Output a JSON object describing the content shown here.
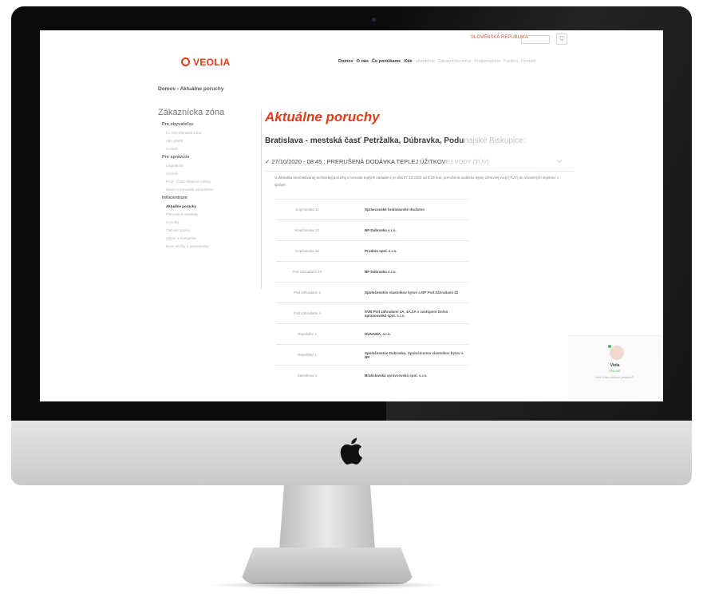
{
  "site": {
    "region_link": "SLOVENSKÁ REPUBLIKA",
    "search_button": "Q",
    "logo_text": "VEOLIA",
    "nav": [
      {
        "label": "Domov",
        "strong": true
      },
      {
        "label": "O nás",
        "strong": true
      },
      {
        "label": "Čo ponúkame",
        "strong": true
      },
      {
        "label": "Kde",
        "strong": true
      },
      {
        "label": "pôsobíme",
        "strong": false
      },
      {
        "label": "Zákaznícka zóna",
        "strong": false
      },
      {
        "label": "Podporujeme",
        "strong": false
      },
      {
        "label": "Kariéra",
        "strong": false
      },
      {
        "label": "Kontakt",
        "strong": false
      }
    ],
    "breadcrumb": "Domov › Aktuálne poruchy"
  },
  "sidebar": {
    "title": "Zákaznícka zóna",
    "groups": [
      {
        "heading": "Pre obyvateľov",
        "items": [
          "Čo řieš klientská zóna",
          "Ako ušetriť",
          "Kontakt"
        ]
      },
      {
        "heading": "Pre správcov",
        "items": [
          "Legislatíva",
          "Vzorník",
          "FAQ - Často kladené otázky",
          "Návrh a prevzatie vodomerov"
        ]
      },
      {
        "heading": "Infocentrum",
        "items": [
          "Aktuálne poruchy",
          "Plánované odstávky",
          "Cenníky",
          "Tlačové správy",
          "Zákon o energetike",
          "Nové služby a pripomienky"
        ]
      }
    ],
    "active_item": "Aktuálne poruchy"
  },
  "main": {
    "title": "Aktuálne poruchy",
    "location_bold": "Bratislava - mestská časť Petržalka, Dúbravka, Podu",
    "location_faded": "najské Biskupice:",
    "incident_bold": "✓ 27/10/2020 - 08:45 : PRERUŠENÁ DODÁVKA TEPLEJ ÚŽITKOV",
    "incident_faded": "EJ VODY (TÚV)",
    "description": "V dôsledku neočakávanej technickej poruchy v rozvode teplých zariadení, je dňa 27.10.2020 od 8:29 hod. prerušená dodávka teplej úžitkovej vody (TÚV) do uvedených objektov v správe:",
    "rows": [
      {
        "address": "Kopčianska 11",
        "dash": "-",
        "manager": "Správcovské bratislavské družstvo"
      },
      {
        "address": "Kopčianska 13",
        "dash": "-",
        "manager": "BP Dúbravka s.r.o."
      },
      {
        "address": "Kopčianska 15",
        "dash": "-",
        "manager": "Prodom spol. s.r.o."
      },
      {
        "address": "Pod záhradami 2A",
        "dash": "-",
        "manager": "BP Dúbravka s.r.o."
      },
      {
        "address": "Pod záhradami 2",
        "dash": "-",
        "manager": "Spoločenstvo vlastníkov bytov a NP Pod Záhradami 42"
      },
      {
        "address": "Pod záhradami 4",
        "dash": "-",
        "manager": "SVB Pod záhradami 4A, 4A,2A v zastúpení Dolná správcovská spol. s.r.o."
      },
      {
        "address": "Republiky 1",
        "dash": "-",
        "manager": "DUNAMA, s.r.o."
      },
      {
        "address": "Republiky 1",
        "dash": "-",
        "manager": "Spoločenstvo Dubravka, Spoločenstvo vlastníkov bytov a NP"
      },
      {
        "address": "Sasinkova 1",
        "dash": "-",
        "manager": "Bratislavská správcovská spol. s.r.o."
      }
    ]
  },
  "chat": {
    "name": "Viola",
    "status": "ONLINE",
    "question": "Ako Vám môžem pomôcť?"
  },
  "colors": {
    "brand": "#e23b1a",
    "bezel": "#0b0b0b",
    "online": "#3cb44b"
  }
}
